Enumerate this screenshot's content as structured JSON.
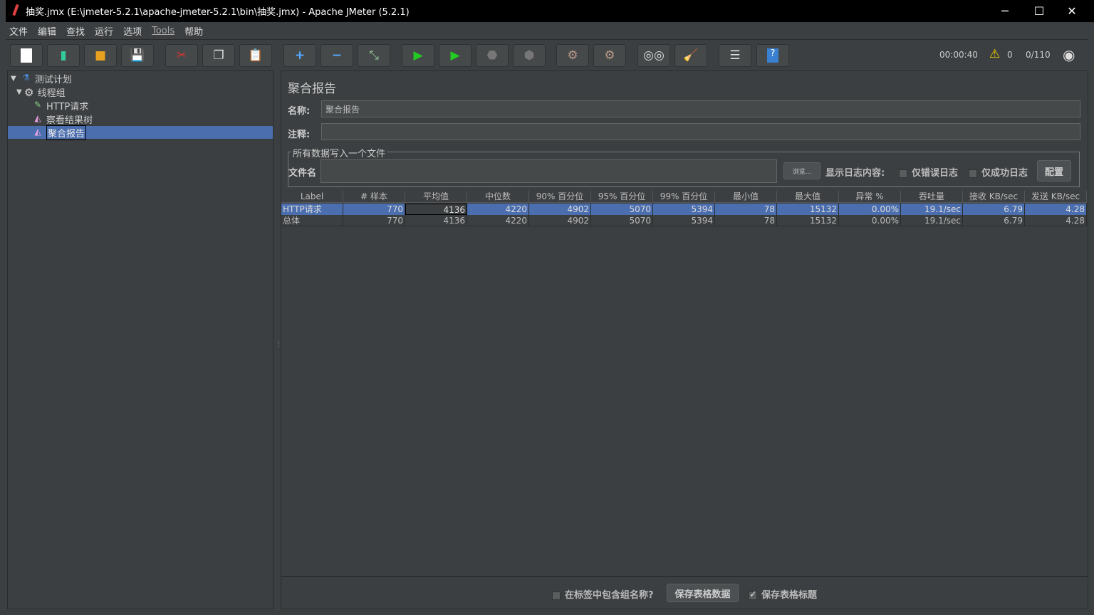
{
  "window": {
    "title": "抽奖.jmx (E:\\jmeter-5.2.1\\apache-jmeter-5.2.1\\bin\\抽奖.jmx) - Apache JMeter (5.2.1)"
  },
  "menu": [
    "文件",
    "编辑",
    "查找",
    "运行",
    "选项",
    "Tools",
    "帮助"
  ],
  "toolbar": {
    "buttons": [
      "new-icon",
      "templates-icon",
      "open-icon",
      "save-icon",
      "cut-icon",
      "copy-icon",
      "paste-icon",
      "expand-icon",
      "collapse-icon",
      "toggle-icon",
      "start-icon",
      "start-no-pause-icon",
      "stop-icon",
      "shutdown-icon",
      "clear-icon",
      "clear-all-icon",
      "search-icon",
      "reset-search-icon",
      "function-helper-icon",
      "help-icon"
    ],
    "elapsed": "00:00:40",
    "warnings": "0",
    "threads": "0/110"
  },
  "tree": [
    {
      "label": "测试计划",
      "icon": "flask-icon"
    },
    {
      "label": "线程组",
      "icon": "gear-icon"
    },
    {
      "label": "HTTP请求",
      "icon": "pipette-icon"
    },
    {
      "label": "察看结果树",
      "icon": "chart-icon"
    },
    {
      "label": "聚合报告",
      "icon": "chart-icon",
      "selected": true
    }
  ],
  "panel": {
    "title": "聚合报告",
    "name_label": "名称:",
    "name_value": "聚合报告",
    "comment_label": "注释:",
    "comment_value": "",
    "group_title": "所有数据写入一个文件",
    "file_label": "文件名",
    "file_value": "",
    "browse": "浏览...",
    "log_label": "显示日志内容:",
    "errors_only": "仅错误日志",
    "success_only": "仅成功日志",
    "configure": "配置"
  },
  "table": {
    "columns": [
      "Label",
      "# 样本",
      "平均值",
      "中位数",
      "90% 百分位",
      "95% 百分位",
      "99% 百分位",
      "最小值",
      "最大值",
      "异常 %",
      "吞吐量",
      "接收 KB/sec",
      "发送 KB/sec"
    ],
    "rows": [
      [
        "HTTP请求",
        "770",
        "4136",
        "4220",
        "4902",
        "5070",
        "5394",
        "78",
        "15132",
        "0.00%",
        "19.1/sec",
        "6.79",
        "4.28"
      ],
      [
        "总体",
        "770",
        "4136",
        "4220",
        "4902",
        "5070",
        "5394",
        "78",
        "15132",
        "0.00%",
        "19.1/sec",
        "6.79",
        "4.28"
      ]
    ]
  },
  "footer": {
    "include_group": "在标签中包含组名称?",
    "include_group_checked": false,
    "save_data": "保存表格数据",
    "save_header": "保存表格标题",
    "save_header_checked": true
  }
}
